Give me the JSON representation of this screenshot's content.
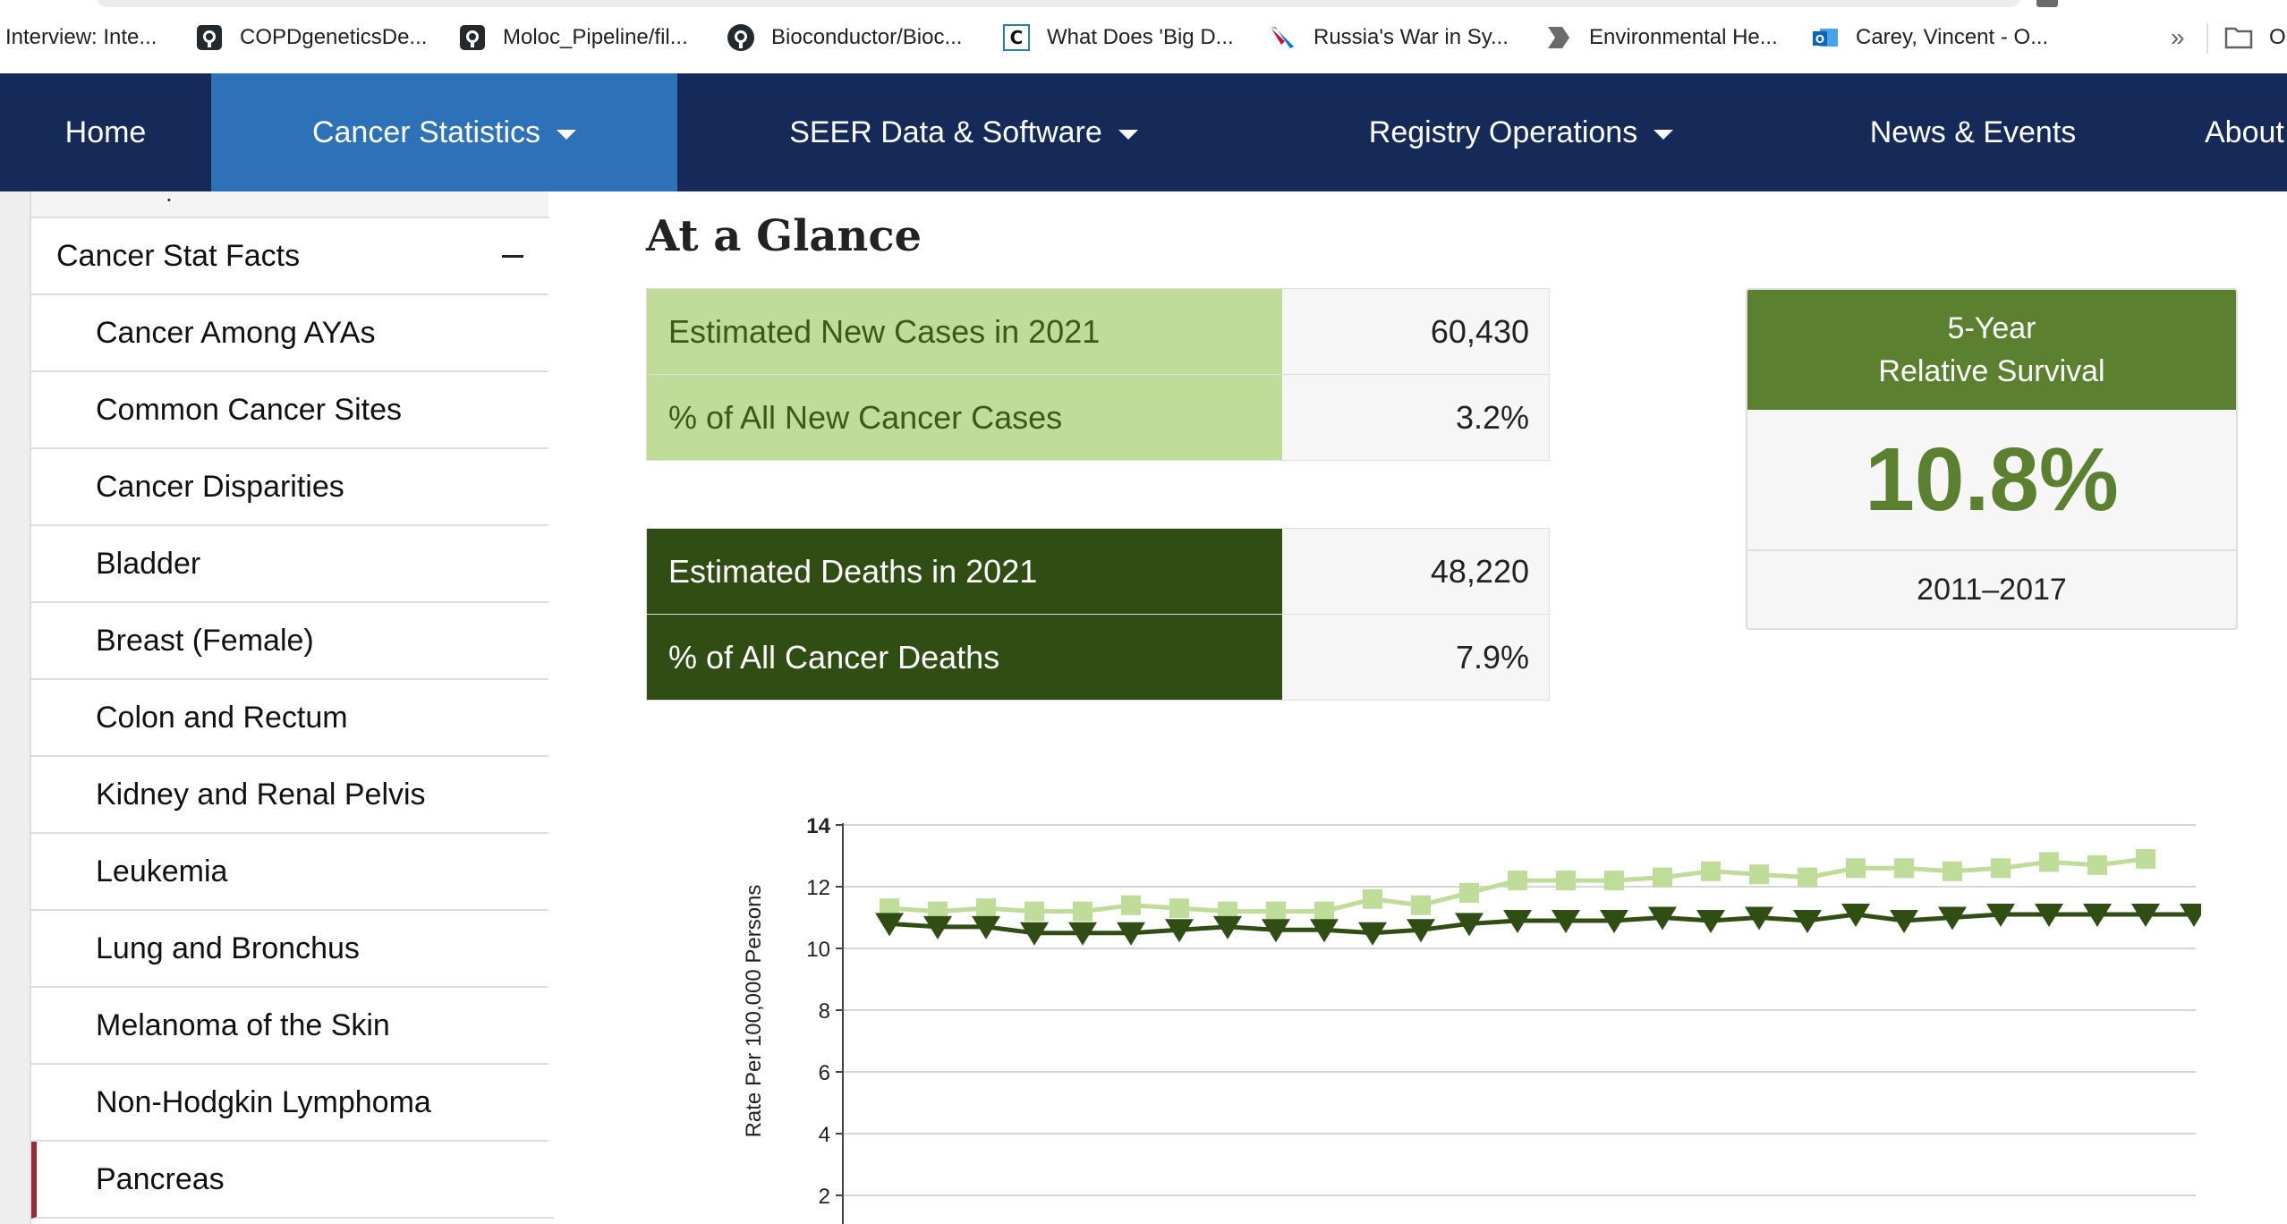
{
  "bookmarks": [
    {
      "label": "Interview: Inte...",
      "icon": "none"
    },
    {
      "label": "COPDgeneticsDe...",
      "icon": "github-icon"
    },
    {
      "label": "Moloc_Pipeline/fil...",
      "icon": "github-icon"
    },
    {
      "label": "Bioconductor/Bioc...",
      "icon": "github-icon"
    },
    {
      "label": "What Does 'Big D...",
      "icon": "c-logo-icon"
    },
    {
      "label": "Russia's War in Sy...",
      "icon": "airline-icon"
    },
    {
      "label": "Environmental He...",
      "icon": "chevron-tag-icon"
    },
    {
      "label": "Carey, Vincent - O...",
      "icon": "outlook-icon"
    }
  ],
  "bookmarks_overflow": "»",
  "bookmarks_folder_label": "O",
  "nav": {
    "items": [
      {
        "label": "Home",
        "dropdown": false,
        "active": false
      },
      {
        "label": "Cancer Statistics",
        "dropdown": true,
        "active": true
      },
      {
        "label": "SEER Data & Software",
        "dropdown": true,
        "active": false
      },
      {
        "label": "Registry Operations",
        "dropdown": true,
        "active": false
      },
      {
        "label": "News & Events",
        "dropdown": false,
        "active": false
      },
      {
        "label": "About",
        "dropdown": false,
        "active": false
      }
    ]
  },
  "sidebar": {
    "section_title": "Cancer Stat Facts",
    "collapse_symbol": "−",
    "items": [
      "Cancer Among AYAs",
      "Common Cancer Sites",
      "Cancer Disparities",
      "Bladder",
      "Breast (Female)",
      "Colon and Rectum",
      "Kidney and Renal Pelvis",
      "Leukemia",
      "Lung and Bronchus",
      "Melanoma of the Skin",
      "Non-Hodgkin Lymphoma",
      "Pancreas"
    ],
    "current_item": "Pancreas"
  },
  "main": {
    "title": "At a Glance",
    "new_cases": [
      {
        "label": "Estimated New Cases in 2021",
        "value": "60,430"
      },
      {
        "label": "% of All New Cancer Cases",
        "value": "3.2%"
      }
    ],
    "deaths": [
      {
        "label": "Estimated Deaths in 2021",
        "value": "48,220"
      },
      {
        "label": "% of All Cancer Deaths",
        "value": "7.9%"
      }
    ],
    "survival": {
      "heading_line1": "5-Year",
      "heading_line2": "Relative Survival",
      "value": "10.8%",
      "years": "2011–2017"
    }
  },
  "colors": {
    "nav_bg": "#162a59",
    "nav_active": "#2d71b8",
    "light_green": "#bfdc98",
    "dark_green": "#304d13",
    "survival_green": "#5a8030",
    "current_marker": "#9b2a36"
  },
  "chart_data": {
    "type": "line",
    "ylabel": "Rate Per 100,000 Persons",
    "y_ticks": [
      2,
      4,
      6,
      8,
      10,
      12,
      14
    ],
    "ylim": [
      0,
      14
    ],
    "x_range": [
      1,
      29
    ],
    "grid": true,
    "series": [
      {
        "marker": "square",
        "color": "#bfdc98",
        "x": [
          1,
          2,
          3,
          4,
          5,
          6,
          7,
          8,
          9,
          10,
          11,
          12,
          13,
          14,
          15,
          16,
          17,
          18,
          19,
          20,
          21,
          22,
          23,
          24,
          25,
          26,
          27,
          28
        ],
        "values": [
          11.3,
          11.2,
          11.3,
          11.2,
          11.2,
          11.4,
          11.3,
          11.2,
          11.2,
          11.2,
          11.6,
          11.4,
          11.8,
          12.2,
          12.2,
          12.2,
          12.3,
          12.5,
          12.4,
          12.3,
          12.6,
          12.6,
          12.5,
          12.6,
          12.8,
          12.7,
          12.9,
          null
        ]
      },
      {
        "marker": "triangle-down",
        "color": "#304d13",
        "x": [
          1,
          2,
          3,
          4,
          5,
          6,
          7,
          8,
          9,
          10,
          11,
          12,
          13,
          14,
          15,
          16,
          17,
          18,
          19,
          20,
          21,
          22,
          23,
          24,
          25,
          26,
          27,
          28
        ],
        "values": [
          10.8,
          10.7,
          10.7,
          10.5,
          10.5,
          10.5,
          10.6,
          10.7,
          10.6,
          10.6,
          10.5,
          10.6,
          10.8,
          10.9,
          10.9,
          10.9,
          11.0,
          10.9,
          11.0,
          10.9,
          11.1,
          10.9,
          11.0,
          11.1,
          11.1,
          11.1,
          11.1,
          11.1
        ]
      }
    ]
  }
}
